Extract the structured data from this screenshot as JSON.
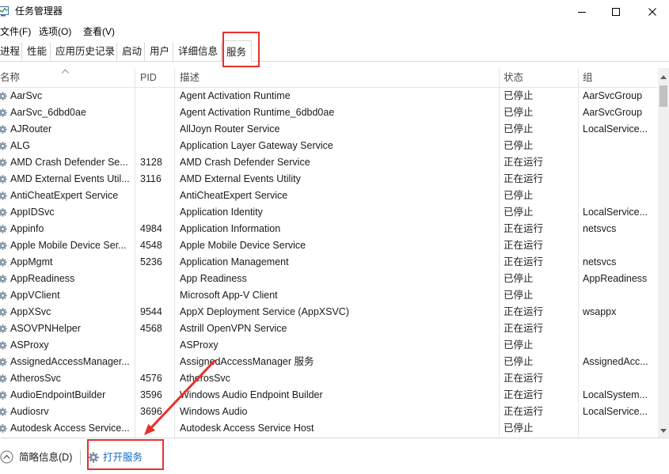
{
  "window": {
    "title": "任务管理器"
  },
  "icons": {
    "app": "task-manager-icon",
    "minimize": "minimize-icon",
    "maximize": "maximize-icon",
    "close": "close-icon",
    "sort": "chevron-up-icon",
    "row": "gear-icon",
    "fewer_details": "chevron-up-circle-icon",
    "open_services": "gear-icon",
    "scroll_up": "triangle-up-icon",
    "scroll_down": "triangle-down-icon"
  },
  "menu": {
    "file": "文件(F)",
    "options": "选项(O)",
    "view": "查看(V)"
  },
  "tabs": [
    {
      "label": "进程",
      "active": false
    },
    {
      "label": "性能",
      "active": false
    },
    {
      "label": "应用历史记录",
      "active": false
    },
    {
      "label": "启动",
      "active": false
    },
    {
      "label": "用户",
      "active": false
    },
    {
      "label": "详细信息",
      "active": false
    },
    {
      "label": "服务",
      "active": true
    }
  ],
  "table": {
    "columns": {
      "name": "名称",
      "pid": "PID",
      "description": "描述",
      "status": "状态",
      "group": "组"
    },
    "sort": {
      "column": "name",
      "direction": "ascending"
    },
    "scroll_position": 0,
    "rows": [
      {
        "name": "AarSvc",
        "pid": "",
        "description": "Agent Activation Runtime",
        "status": "已停止",
        "group": "AarSvcGroup"
      },
      {
        "name": "AarSvc_6dbd0ae",
        "pid": "",
        "description": "Agent Activation Runtime_6dbd0ae",
        "status": "已停止",
        "group": "AarSvcGroup"
      },
      {
        "name": "AJRouter",
        "pid": "",
        "description": "AllJoyn Router Service",
        "status": "已停止",
        "group": "LocalService..."
      },
      {
        "name": "ALG",
        "pid": "",
        "description": "Application Layer Gateway Service",
        "status": "已停止",
        "group": ""
      },
      {
        "name": "AMD Crash Defender Se...",
        "pid": "3128",
        "description": "AMD Crash Defender Service",
        "status": "正在运行",
        "group": ""
      },
      {
        "name": "AMD External Events Util...",
        "pid": "3116",
        "description": "AMD External Events Utility",
        "status": "正在运行",
        "group": ""
      },
      {
        "name": "AntiCheatExpert Service",
        "pid": "",
        "description": "AntiCheatExpert Service",
        "status": "已停止",
        "group": ""
      },
      {
        "name": "AppIDSvc",
        "pid": "",
        "description": "Application Identity",
        "status": "已停止",
        "group": "LocalService..."
      },
      {
        "name": "Appinfo",
        "pid": "4984",
        "description": "Application Information",
        "status": "正在运行",
        "group": "netsvcs"
      },
      {
        "name": "Apple Mobile Device Ser...",
        "pid": "4548",
        "description": "Apple Mobile Device Service",
        "status": "正在运行",
        "group": ""
      },
      {
        "name": "AppMgmt",
        "pid": "5236",
        "description": "Application Management",
        "status": "正在运行",
        "group": "netsvcs"
      },
      {
        "name": "AppReadiness",
        "pid": "",
        "description": "App Readiness",
        "status": "已停止",
        "group": "AppReadiness"
      },
      {
        "name": "AppVClient",
        "pid": "",
        "description": "Microsoft App-V Client",
        "status": "已停止",
        "group": ""
      },
      {
        "name": "AppXSvc",
        "pid": "9544",
        "description": "AppX Deployment Service (AppXSVC)",
        "status": "正在运行",
        "group": "wsappx"
      },
      {
        "name": "ASOVPNHelper",
        "pid": "4568",
        "description": "Astrill OpenVPN Service",
        "status": "正在运行",
        "group": ""
      },
      {
        "name": "ASProxy",
        "pid": "",
        "description": "ASProxy",
        "status": "已停止",
        "group": ""
      },
      {
        "name": "AssignedAccessManager...",
        "pid": "",
        "description": "AssignedAccessManager 服务",
        "status": "已停止",
        "group": "AssignedAcc..."
      },
      {
        "name": "AtherosSvc",
        "pid": "4576",
        "description": "AtherosSvc",
        "status": "正在运行",
        "group": ""
      },
      {
        "name": "AudioEndpointBuilder",
        "pid": "3596",
        "description": "Windows Audio Endpoint Builder",
        "status": "正在运行",
        "group": "LocalSystem..."
      },
      {
        "name": "Audiosrv",
        "pid": "3696",
        "description": "Windows Audio",
        "status": "正在运行",
        "group": "LocalService..."
      },
      {
        "name": "Autodesk Access Service...",
        "pid": "",
        "description": "Autodesk Access Service Host",
        "status": "已停止",
        "group": ""
      }
    ]
  },
  "footer": {
    "fewer_details": "简略信息(D)",
    "open_services": "打开服务"
  },
  "colors": {
    "text": "#1a1a1a",
    "header_text": "#4d4d4d",
    "link": "#0e68c8",
    "divider": "#e5e5e5",
    "annotation": "#e8312c",
    "scroll_track": "#f0f0f0",
    "scroll_thumb": "#c1c1c1"
  }
}
